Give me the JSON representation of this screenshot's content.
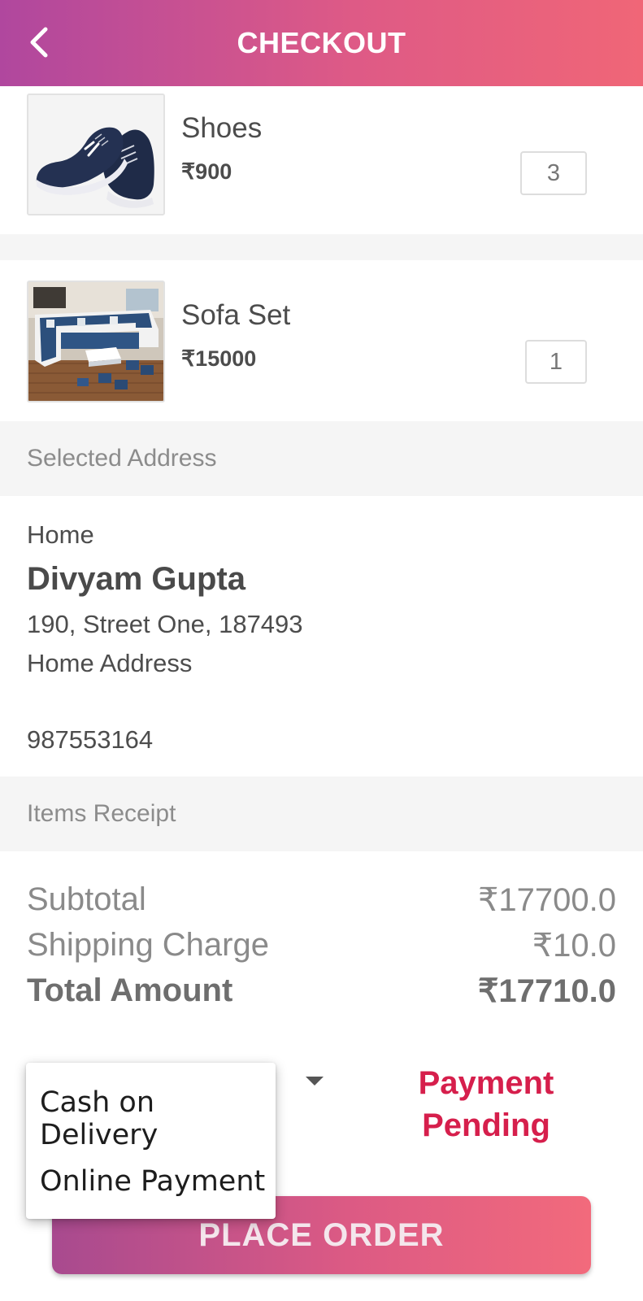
{
  "header": {
    "title": "CHECKOUT"
  },
  "items": [
    {
      "name": "Shoes",
      "price": "₹900",
      "quantity": "3"
    },
    {
      "name": "Sofa Set",
      "price": "₹15000",
      "quantity": "1"
    }
  ],
  "address_section": {
    "heading": "Selected Address",
    "type": "Home",
    "name": "Divyam Gupta",
    "line1": "190, Street One, 187493",
    "line2": "Home Address",
    "phone": "987553164"
  },
  "receipt": {
    "heading": "Items Receipt",
    "subtotal_label": "Subtotal",
    "subtotal_value": "₹17700.0",
    "shipping_label": "Shipping Charge",
    "shipping_value": "₹10.0",
    "total_label": "Total Amount",
    "total_value": "₹17710.0"
  },
  "payment": {
    "options": [
      "Cash on Delivery",
      "Online Payment"
    ],
    "status_line1": "Payment",
    "status_line2": "Pending"
  },
  "place_order_label": "PLACE ORDER",
  "colors": {
    "header_gradient_start": "#b0479e",
    "header_gradient_end": "#f06677",
    "status_red": "#d61f4c",
    "section_bg": "#f5f5f5"
  }
}
